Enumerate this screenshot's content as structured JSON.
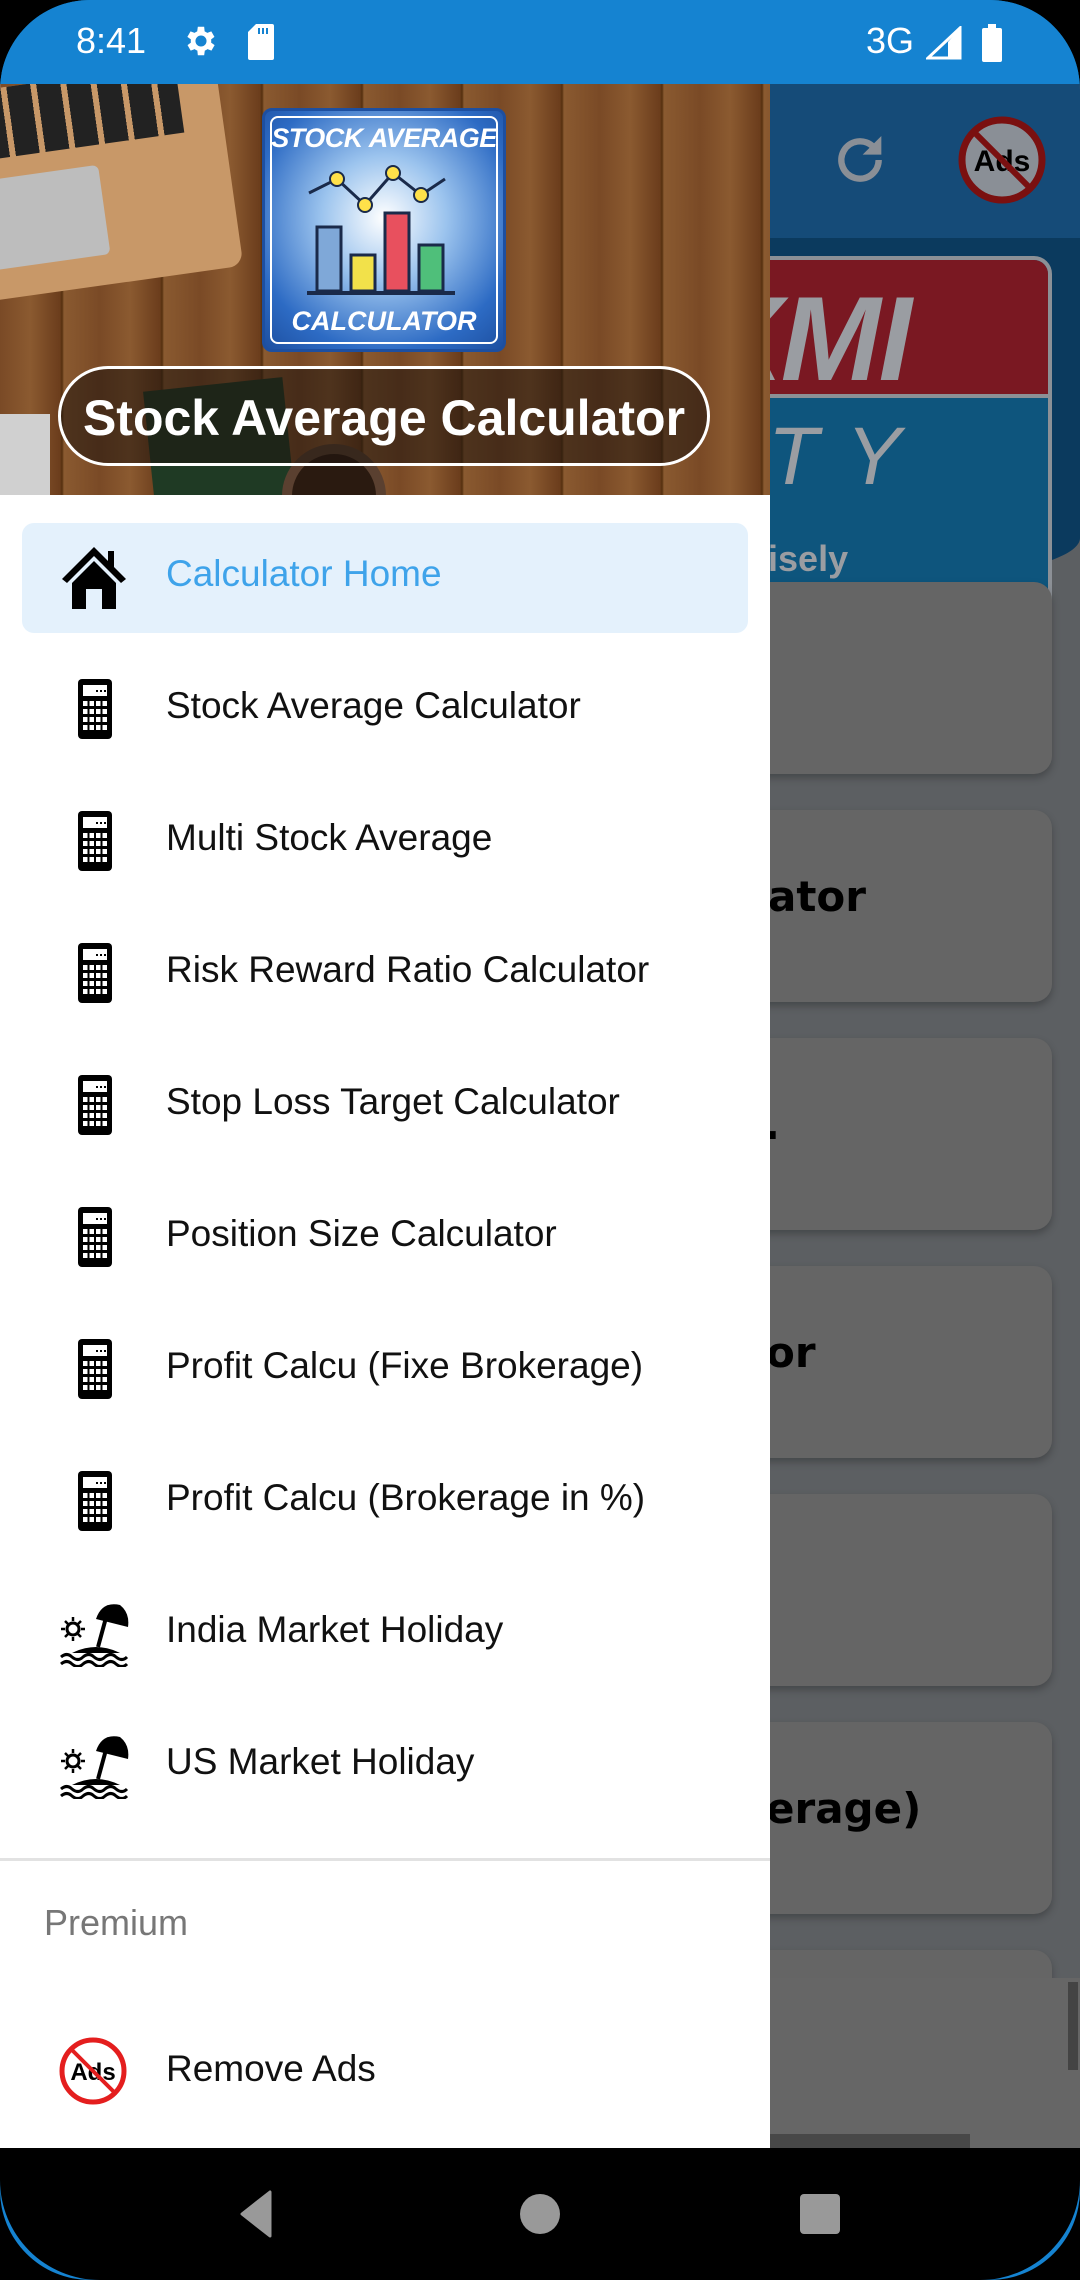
{
  "status_bar": {
    "time": "8:41",
    "network": "3G",
    "icons": [
      "gear-icon",
      "sd-card-icon",
      "signal-icon",
      "battery-icon"
    ]
  },
  "app_toolbar": {
    "actions": [
      {
        "name": "refresh",
        "icon": "refresh-icon"
      },
      {
        "name": "remove-ads",
        "icon": "no-ads-icon",
        "text": "Ads"
      }
    ]
  },
  "banner": {
    "line1": "AXMI",
    "line2": "DITY",
    "tagline": "esting wisely"
  },
  "background_cards": [
    {
      "text": ""
    },
    {
      "text": "ator"
    },
    {
      "text": "."
    },
    {
      "text": "or"
    },
    {
      "text": ""
    },
    {
      "text": "erage)"
    }
  ],
  "drawer": {
    "header": {
      "logo_top": "STOCK AVERAGE",
      "logo_bottom": "CALCULATOR",
      "title": "Stock Average Calculator"
    },
    "items": [
      {
        "label": "Calculator Home",
        "icon": "home-icon",
        "active": true
      },
      {
        "label": "Stock Average Calculator",
        "icon": "calculator-icon",
        "active": false
      },
      {
        "label": "Multi Stock Average",
        "icon": "calculator-icon",
        "active": false
      },
      {
        "label": "Risk Reward Ratio Calculator",
        "icon": "calculator-icon",
        "active": false
      },
      {
        "label": "Stop Loss Target Calculator",
        "icon": "calculator-icon",
        "active": false
      },
      {
        "label": "Position Size Calculator",
        "icon": "calculator-icon",
        "active": false
      },
      {
        "label": "Profit Calcu (Fixe Brokerage)",
        "icon": "calculator-icon",
        "active": false
      },
      {
        "label": "Profit Calcu (Brokerage in %)",
        "icon": "calculator-icon",
        "active": false
      },
      {
        "label": "India Market Holiday",
        "icon": "beach-icon",
        "active": false
      },
      {
        "label": "US Market Holiday",
        "icon": "beach-icon",
        "active": false
      }
    ],
    "premium_section": {
      "title": "Premium",
      "items": [
        {
          "label": "Remove Ads",
          "icon": "no-ads-icon",
          "icon_text": "Ads"
        }
      ]
    }
  },
  "colors": {
    "status_bar": "#1583d1",
    "active_item_bg": "#e4f1fc",
    "active_item_text": "#3ea3ea",
    "toolbar": "#154b78"
  },
  "system_nav": {
    "buttons": [
      "back",
      "home",
      "recents"
    ]
  }
}
